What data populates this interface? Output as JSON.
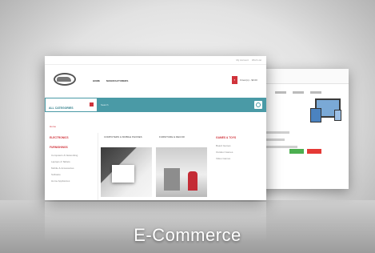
{
  "caption": "E-Commerce",
  "front": {
    "top_links": [
      "My Account",
      "Wish List"
    ],
    "nav": [
      "HOME",
      "MANUFACTURERS"
    ],
    "cart_text": "0 item(s) - $0.00",
    "category_select": "ALL CATEGORIES",
    "search_placeholder": "Search",
    "breadcrumb": "Home",
    "sidebar": {
      "head1": "ELECTRONICS",
      "head2": "FURNISHINGS",
      "items": [
        "Computers & Networking",
        "Laptops & Tablets",
        "Mobile & Accessories",
        "Software",
        "Home Appliances"
      ]
    },
    "products": [
      "COMPUTERS & MOBILE PHONES",
      "FURNITURE & DECOR"
    ],
    "right": {
      "head": "GAMES & TOYS",
      "items": [
        "Board Games",
        "Outdoor Games",
        "Video Games"
      ]
    }
  },
  "colors": {
    "accent": "#4a9aa6",
    "brand_red": "#d0333b",
    "green": "#4caf50",
    "red": "#e53935"
  }
}
